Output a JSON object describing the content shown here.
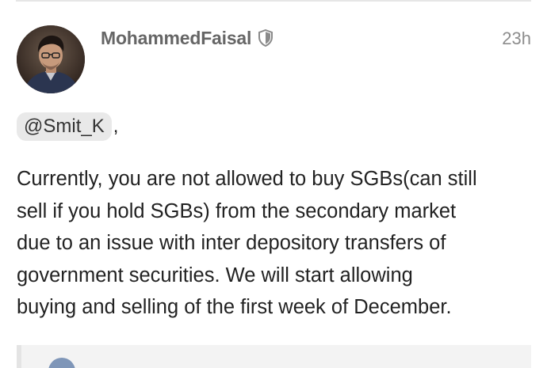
{
  "post": {
    "author": {
      "username": "MohammedFaisal",
      "badge_icon": "shield-icon"
    },
    "timestamp": "23h",
    "mention": "@Smit_K",
    "mention_suffix": ",",
    "body_lines": [
      "Currently, you are not allowed to buy SGBs(can still",
      "sell if you hold SGBs) from the secondary market",
      "due to an issue with inter depository transfers of",
      "government securities. We will start allowing",
      "buying and selling of the first week of December."
    ]
  },
  "colors": {
    "username": "#666666",
    "timestamp": "#8c8c8c",
    "mention_bg": "#e9e9e9",
    "quote_bg": "#f3f3f3",
    "quote_border": "#e4e4e4"
  }
}
